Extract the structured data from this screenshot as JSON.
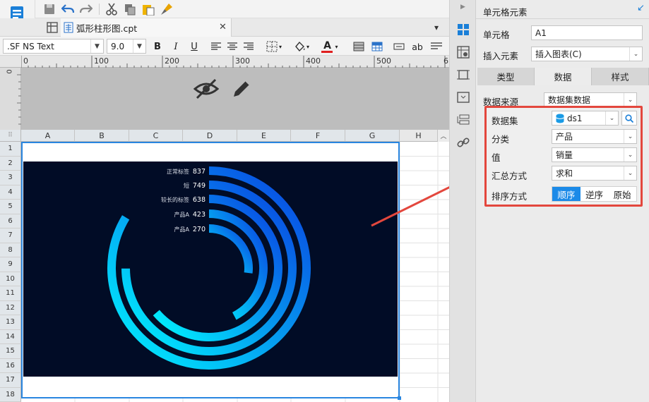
{
  "document": {
    "tab_title": "弧形柱形图.cpt"
  },
  "format": {
    "font_name": ".SF NS Text",
    "font_size": "9.0",
    "bold": "B",
    "italic": "I",
    "underline": "U",
    "ab": "ab",
    "text_color": "#e02020"
  },
  "ruler": {
    "marks": [
      "0",
      "100",
      "200",
      "300",
      "400",
      "500",
      "6"
    ],
    "vmark": "0"
  },
  "columns": [
    "A",
    "B",
    "C",
    "D",
    "E",
    "F",
    "G",
    "H"
  ],
  "rows": [
    "1",
    "2",
    "3",
    "4",
    "5",
    "6",
    "7",
    "8",
    "9",
    "10",
    "11",
    "12",
    "13",
    "14",
    "15",
    "16",
    "17",
    "18"
  ],
  "chart_data": {
    "type": "bar",
    "categories": [
      "正常标签",
      "短",
      "较长的标签",
      "产品A",
      "产品A"
    ],
    "values": [
      837,
      749,
      638,
      423,
      270
    ],
    "background": "#010c26",
    "colors": [
      "#00f5ff",
      "#0a3fe0"
    ]
  },
  "panel": {
    "title": "单元格元素",
    "cell_label": "单元格",
    "cell_value": "A1",
    "insert_label": "插入元素",
    "insert_value": "插入图表(C)",
    "tabs": [
      "类型",
      "数据",
      "样式"
    ],
    "source_label": "数据来源",
    "source_value": "数据集数据",
    "dataset_label": "数据集",
    "dataset_value": "ds1",
    "category_label": "分类",
    "category_value": "产品",
    "value_label": "值",
    "value_value": "销量",
    "agg_label": "汇总方式",
    "agg_value": "求和",
    "sort_label": "排序方式",
    "sort_options": [
      "顺序",
      "逆序",
      "原始"
    ],
    "sort_selected": "顺序"
  }
}
